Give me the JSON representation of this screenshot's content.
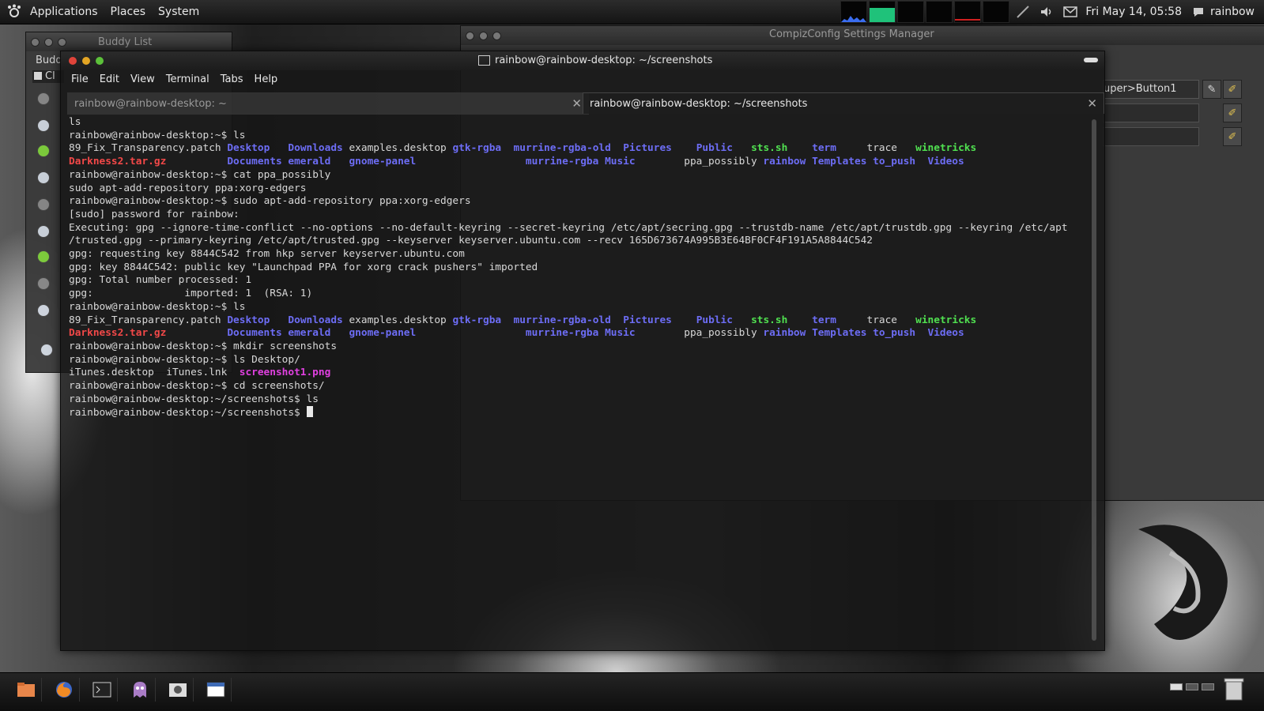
{
  "top_panel": {
    "menus": [
      "Applications",
      "Places",
      "System"
    ],
    "clock": "Fri May 14, 05:58",
    "user": "rainbow"
  },
  "buddy_window": {
    "title": "Buddy List",
    "menu_label": "Budd",
    "group_label": "Cl"
  },
  "compiz_window": {
    "title": "CompizConfig Settings Manager",
    "binding_value": "uper>Button1"
  },
  "terminal": {
    "window_title": "rainbow@rainbow-desktop: ~/screenshots",
    "menu": [
      "File",
      "Edit",
      "View",
      "Terminal",
      "Tabs",
      "Help"
    ],
    "tabs": [
      {
        "label": "rainbow@rainbow-desktop: ~",
        "active": false
      },
      {
        "label": "rainbow@rainbow-desktop: ~/screenshots",
        "active": true
      }
    ],
    "prompt_home": "rainbow@rainbow-desktop:~$",
    "prompt_screens": "rainbow@rainbow-desktop:~/screenshots$",
    "cmd_ls": "ls",
    "cmd_cat": "cat ppa_possibly",
    "cat_output": "sudo apt-add-repository ppa:xorg-edgers",
    "cmd_add_repo": "sudo apt-add-repository ppa:xorg-edgers",
    "sudo_prompt": "[sudo] password for rainbow:",
    "exec_line1": "Executing: gpg --ignore-time-conflict --no-options --no-default-keyring --secret-keyring /etc/apt/secring.gpg --trustdb-name /etc/apt/trustdb.gpg --keyring /etc/apt",
    "exec_line2": "/trusted.gpg --primary-keyring /etc/apt/trusted.gpg --keyserver keyserver.ubuntu.com --recv 165D673674A995B3E64BF0CF4F191A5A8844C542",
    "gpg_line1": "gpg: requesting key 8844C542 from hkp server keyserver.ubuntu.com",
    "gpg_line2": "gpg: key 8844C542: public key \"Launchpad PPA for xorg crack pushers\" imported",
    "gpg_line3": "gpg: Total number processed: 1",
    "gpg_line4": "gpg:               imported: 1  (RSA: 1)",
    "cmd_mkdir": "mkdir screenshots",
    "cmd_ls_desktop": "ls Desktop/",
    "desktop_files_plain": "iTunes.desktop  iTunes.lnk  ",
    "desktop_file_img": "screenshot1.png",
    "cmd_cd": "cd screenshots/",
    "ls_row1": [
      {
        "name": "89_Fix_Transparency.patch",
        "type": "file"
      },
      {
        "name": "Desktop",
        "type": "dir"
      },
      {
        "name": "Downloads",
        "type": "dir"
      },
      {
        "name": "examples.desktop",
        "type": "file"
      },
      {
        "name": "gtk-rgba",
        "type": "dir"
      },
      {
        "name": "murrine-rgba-old",
        "type": "dir"
      },
      {
        "name": "Pictures",
        "type": "dir"
      },
      {
        "name": "Public",
        "type": "dir"
      },
      {
        "name": "sts.sh",
        "type": "exec"
      },
      {
        "name": "term",
        "type": "dir"
      },
      {
        "name": "trace",
        "type": "file"
      },
      {
        "name": "winetricks",
        "type": "exec"
      }
    ],
    "ls_row2": [
      {
        "name": "Darkness2.tar.gz",
        "type": "archive"
      },
      {
        "name": "Documents",
        "type": "dir"
      },
      {
        "name": "emerald",
        "type": "dir"
      },
      {
        "name": "gnome-panel",
        "type": "dir"
      },
      {
        "name": "murrine-rgba",
        "type": "dir"
      },
      {
        "name": "Music",
        "type": "dir"
      },
      {
        "name": "ppa_possibly",
        "type": "file"
      },
      {
        "name": "rainbow",
        "type": "dir"
      },
      {
        "name": "Templates",
        "type": "dir"
      },
      {
        "name": "to_push",
        "type": "dir"
      },
      {
        "name": "Videos",
        "type": "dir"
      }
    ]
  },
  "colors": {
    "dir": "#6d6df5",
    "exec": "#50e050",
    "archive": "#f24848",
    "image": "#e040e0"
  }
}
